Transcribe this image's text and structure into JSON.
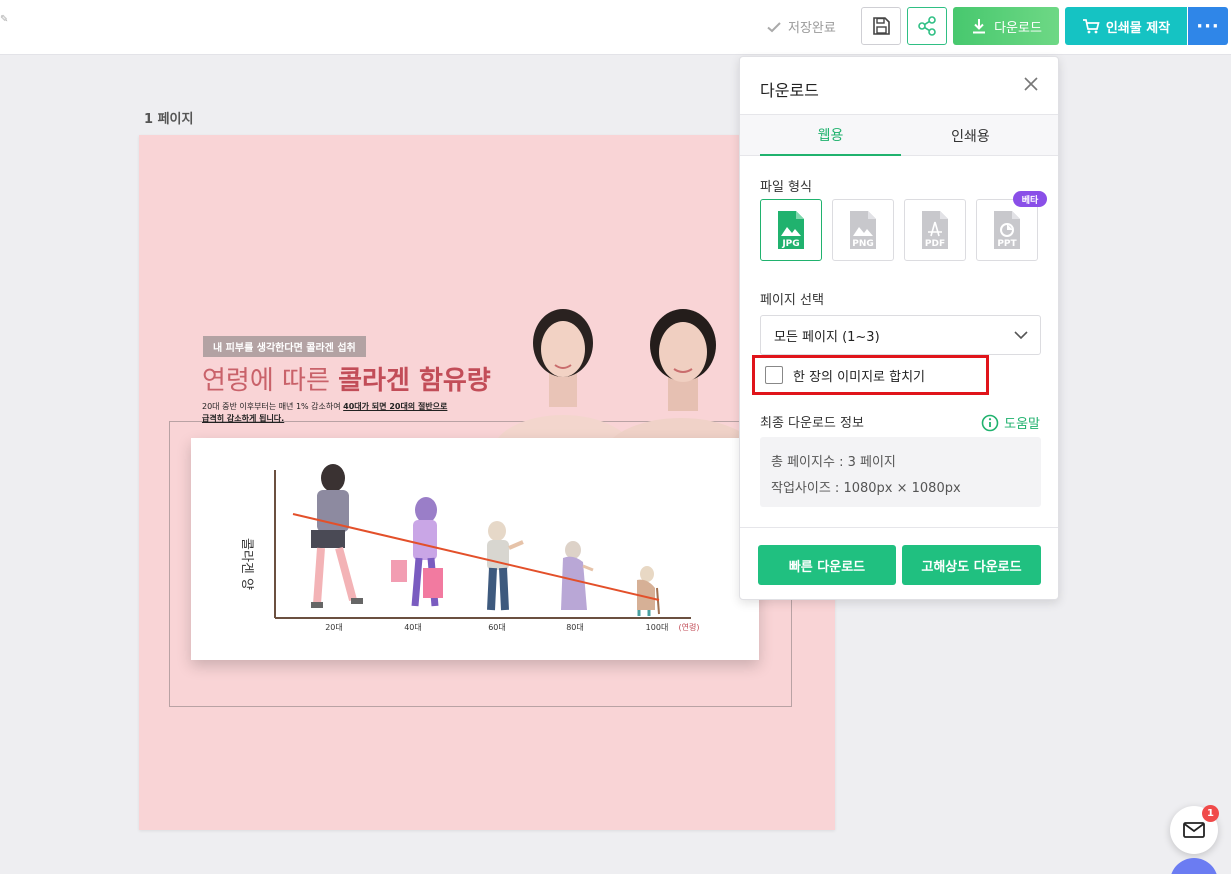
{
  "toolbar": {
    "saved_label": "저장완료",
    "download_label": "다운로드",
    "print_label": "인쇄물 제작",
    "more_label": "···"
  },
  "canvas": {
    "page_label": "1 페이지",
    "design": {
      "tagline": "내 피부를 생각한다면 콜라겐 섭취",
      "headline_light": "연령에 따른 ",
      "headline_bold": "콜라겐 함유량",
      "subtext_plain": "20대 중반 이후부터는 매년 1% 감소하여 ",
      "subtext_underlined_1": "40대가 되면 20대의 절반으로",
      "subtext_underlined_2": "급격히 감소하게 됩니다.",
      "chart": {
        "ylabel": "콜라겐 양",
        "ticks": [
          "20대",
          "40대",
          "60대",
          "80대",
          "100대"
        ],
        "xunit": "(연령)"
      }
    }
  },
  "panel": {
    "title": "다운로드",
    "tabs": [
      "웹용",
      "인쇄용"
    ],
    "file_format_label": "파일 형식",
    "formats": [
      "JPG",
      "PNG",
      "PDF",
      "PPT"
    ],
    "beta_label": "베타",
    "page_select_label": "페이지 선택",
    "page_select_value": "모든 페이지 (1~3)",
    "merge_label": "한 장의 이미지로 합치기",
    "final_info_label": "최종 다운로드 정보",
    "help_label": "도움말",
    "info_pages": "총 페이지수 : 3 페이지",
    "info_size": "작업사이즈 : 1080px × 1080px",
    "quick_download": "빠른 다운로드",
    "hires_download": "고해상도 다운로드"
  },
  "floating": {
    "mail_badge": "1"
  },
  "colors": {
    "accent_green": "#20b26e",
    "download_green": "#47c86e",
    "print_teal": "#15c3c3",
    "more_blue": "#2f86e8",
    "page_pink": "#f9d4d6",
    "highlight_red": "#e0141a"
  }
}
